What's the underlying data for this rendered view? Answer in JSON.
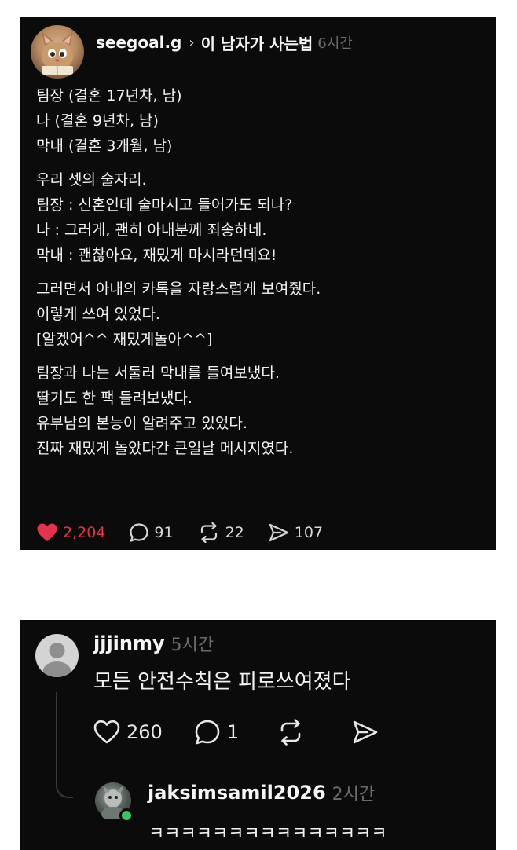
{
  "post": {
    "author": "seegoal.g",
    "separator": "›",
    "topic": "이 남자가 사는법",
    "time": "6시간",
    "paragraphs": [
      {
        "lines": [
          "팀장 (결혼 17년차, 남)",
          "나 (결혼 9년차, 남)",
          "막내 (결혼 3개월, 남)"
        ]
      },
      {
        "lines": [
          "우리 셋의 술자리.",
          "팀장 : 신혼인데 술마시고 들어가도 되나?",
          "나 : 그러게, 괜히 아내분께 죄송하네.",
          "막내 : 괜찮아요, 재밌게 마시라던데요!"
        ]
      },
      {
        "lines": [
          "그러면서 아내의 카톡을 자랑스럽게 보여줬다.",
          "이렇게 쓰여 있었다.",
          "[알겠어^^ 재밌게놀아^^]"
        ]
      },
      {
        "lines": [
          "팀장과 나는 서둘러 막내를 들여보냈다.",
          "딸기도 한 팩 들려보냈다.",
          "유부남의 본능이 알려주고 있었다.",
          "진짜 재밌게 놀았다간 큰일날 메시지였다."
        ]
      }
    ],
    "stats": {
      "likes": "2,204",
      "comments": "91",
      "reposts": "22",
      "shares": "107"
    },
    "like_color": "#e0334f"
  },
  "comment": {
    "author": "jjjinmy",
    "time": "5시간",
    "text": "모든 안전수칙은 피로쓰여졌다",
    "stats": {
      "likes": "260",
      "comments": "1"
    }
  },
  "reply": {
    "author": "jaksimsamil2026",
    "time": "2시간",
    "text": "ㅋㅋㅋㅋㅋㅋㅋㅋㅋㅋㅋㅋㅋㅋㅋ",
    "online_color": "#3ec45a"
  }
}
